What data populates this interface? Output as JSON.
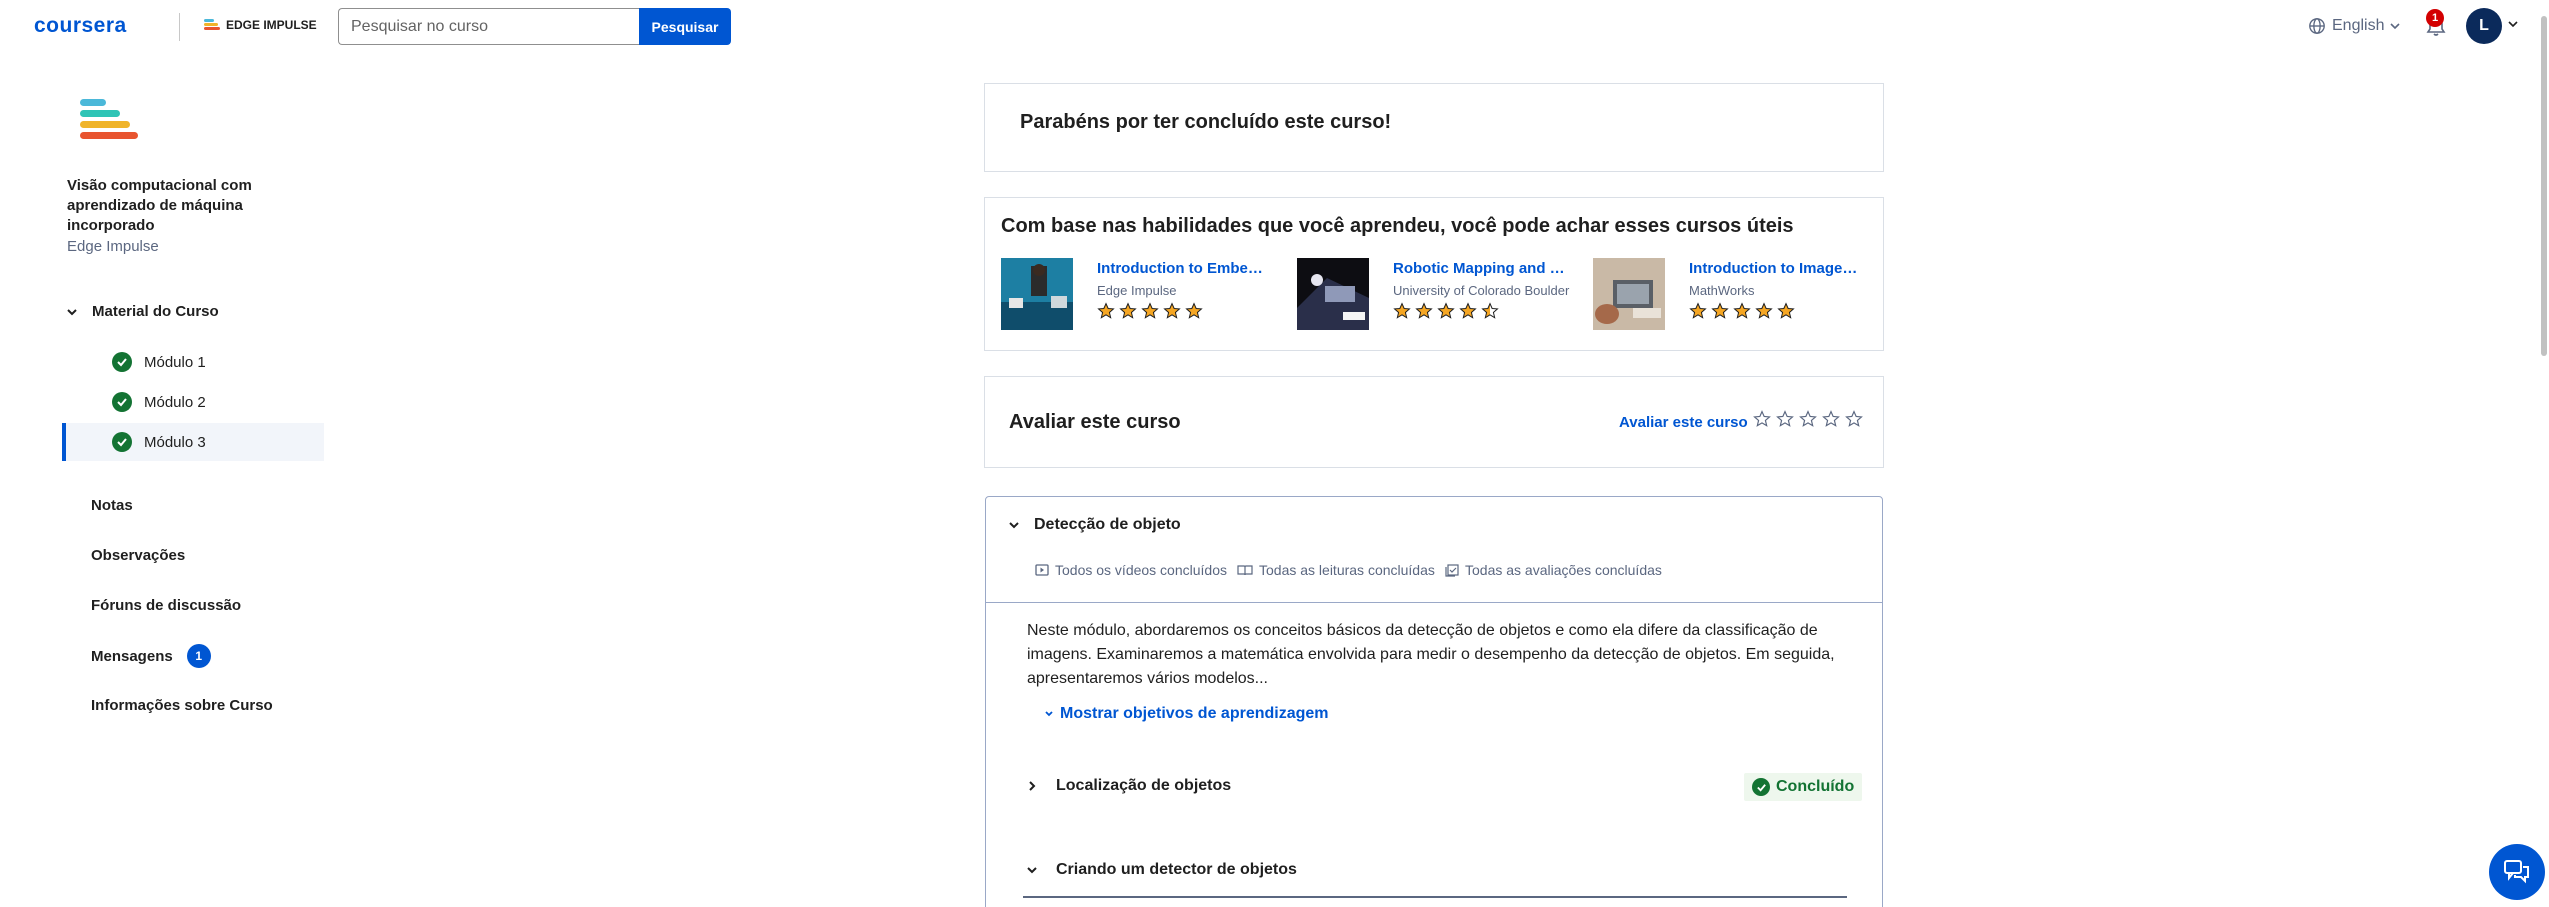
{
  "header": {
    "logo": "coursera",
    "partner": "EDGE IMPULSE",
    "search_placeholder": "Pesquisar no curso",
    "search_button": "Pesquisar",
    "language": "English",
    "notification_count": "1",
    "avatar_initial": "L"
  },
  "sidebar": {
    "course_title": "Visão computacional com aprendizado de máquina incorporado",
    "course_partner": "Edge Impulse",
    "material_label": "Material do Curso",
    "modules": [
      {
        "label": "Módulo 1"
      },
      {
        "label": "Módulo 2"
      },
      {
        "label": "Módulo 3"
      }
    ],
    "links": {
      "notas": "Notas",
      "observacoes": "Observações",
      "foruns": "Fóruns de discussão",
      "mensagens": "Mensagens",
      "mensagens_count": "1",
      "informacoes": "Informações sobre Curso"
    }
  },
  "main": {
    "congrats": "Parabéns por ter concluído este curso!",
    "recommendations": {
      "title": "Com base nas habilidades que você aprendeu, você pode achar esses cursos úteis",
      "courses": [
        {
          "title": "Introduction to Embedded Machine Learning",
          "partner": "Edge Impulse",
          "rating": 5
        },
        {
          "title": "Robotic Mapping and Trajectory Generation",
          "partner": "University of Colorado Boulder",
          "rating": 4.5
        },
        {
          "title": "Introduction to Image Processing",
          "partner": "MathWorks",
          "rating": 5
        }
      ]
    },
    "rate": {
      "title": "Avaliar este curso",
      "link": "Avaliar este curso"
    },
    "module": {
      "title": "Detecção de objeto",
      "status_videos": "Todos os vídeos concluídos",
      "status_readings": "Todas as leituras concluídas",
      "status_assessments": "Todas as avaliações concluídas",
      "description": "Neste módulo, abordaremos os conceitos básicos da detecção de objetos e como ela difere da classificação de imagens. Examinaremos a matemática envolvida para medir o desempenho da detecção de objetos. Em seguida, apresentaremos vários modelos...",
      "learning_objectives": "Mostrar objetivos de aprendizagem",
      "lessons": [
        {
          "title": "Localização de objetos",
          "status": "Concluído"
        },
        {
          "title": "Criando um detector de objetos"
        }
      ]
    }
  },
  "colors": {
    "brand": "#0056d2",
    "success": "#137333",
    "badge_red": "#d30001",
    "star": "#f5a623"
  }
}
